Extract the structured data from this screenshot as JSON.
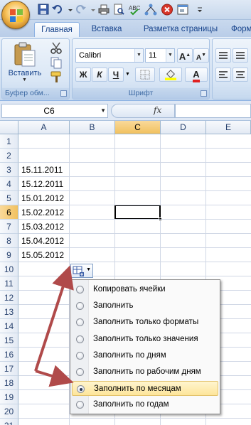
{
  "ribbon": {
    "tabs": [
      "Главная",
      "Вставка",
      "Разметка страницы",
      "Форм"
    ],
    "clipboard": {
      "paste_label": "Вставить",
      "group_label": "Буфер обм..."
    },
    "font": {
      "name": "Calibri",
      "size": "11",
      "group_label": "Шрифт",
      "bold": "Ж",
      "italic": "К",
      "underline": "Ч",
      "grow": "A",
      "shrink": "A",
      "color_letter": "A"
    }
  },
  "formula_bar": {
    "name_box": "C6",
    "fx": "fx",
    "value": ""
  },
  "grid": {
    "columns": [
      "A",
      "B",
      "C",
      "D",
      "E"
    ],
    "selected_column": "C",
    "rows": [
      "1",
      "2",
      "3",
      "4",
      "5",
      "6",
      "7",
      "8",
      "9",
      "10",
      "11",
      "12",
      "13",
      "14",
      "15",
      "16",
      "17",
      "18",
      "19",
      "20",
      "21"
    ],
    "selected_row": "6",
    "dates": [
      "15.11.2011",
      "15.12.2011",
      "15.01.2012",
      "15.02.2012",
      "15.03.2012",
      "15.04.2012",
      "15.05.2012"
    ]
  },
  "autofill_menu": {
    "options": [
      "Копировать ячейки",
      "Заполнить",
      "Заполнить только форматы",
      "Заполнить только значения",
      "Заполнить по дням",
      "Заполнить по рабочим дням",
      "Заполнить по месяцам",
      "Заполнить по годам"
    ],
    "selected": "Заполнить по месяцам"
  },
  "colors": {
    "annotation_arrow": "#b04a4a",
    "highlight": "#fde59a",
    "ribbon_text": "#15428b"
  }
}
